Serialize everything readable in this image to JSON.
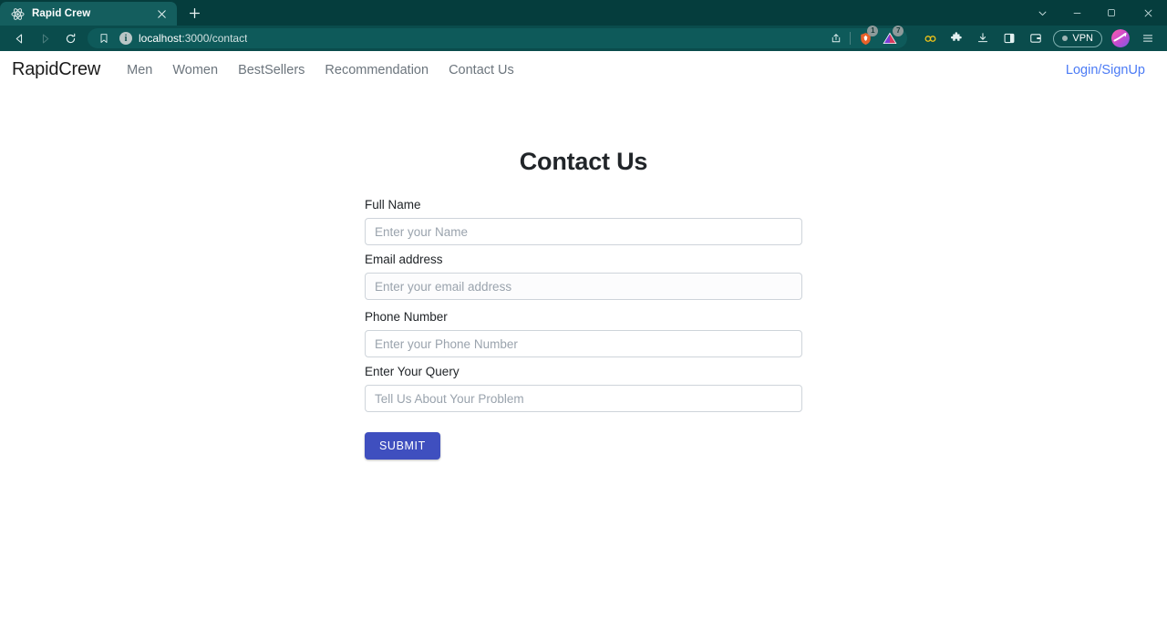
{
  "browser": {
    "tab": {
      "title": "Rapid Crew",
      "favicon_icon": "react-atom-icon",
      "close_icon": "close-icon"
    },
    "new_tab_label": "+",
    "window_controls": {
      "tab_search_icon": "chevron-down-icon",
      "minimize_icon": "minimize-icon",
      "maximize_icon": "maximize-icon",
      "close_icon": "close-icon"
    },
    "nav": {
      "back_icon": "back-arrow-icon",
      "forward_icon": "forward-arrow-icon",
      "reload_icon": "reload-icon",
      "bookmark_icon": "bookmark-icon"
    },
    "omnibox": {
      "site_info_icon": "info-circle-icon",
      "url_host": "localhost",
      "url_path": ":3000/contact",
      "share_icon": "share-icon",
      "shield_icon": "brave-shield-icon",
      "shield_badge": "1",
      "warning_icon": "triangle-alert-icon",
      "warning_badge": "7"
    },
    "toolbar_right": {
      "leo_icon": "leo-ai-icon",
      "extensions_icon": "puzzle-extension-icon",
      "downloads_icon": "download-icon",
      "sidebar_icon": "sidebar-panel-icon",
      "wallet_icon": "brave-wallet-icon",
      "vpn_label": "VPN",
      "profile_icon": "profile-avatar-icon",
      "menu_icon": "hamburger-menu-icon"
    }
  },
  "site": {
    "brand": "RapidCrew",
    "nav_links": [
      {
        "label": "Men"
      },
      {
        "label": "Women"
      },
      {
        "label": "BestSellers"
      },
      {
        "label": "Recommendation"
      },
      {
        "label": "Contact Us"
      }
    ],
    "auth_link": "Login/SignUp"
  },
  "page": {
    "title": "Contact Us",
    "fields": [
      {
        "label": "Full Name",
        "placeholder": "Enter your Name",
        "value": ""
      },
      {
        "label": "Email address",
        "placeholder": "Enter your email address",
        "value": ""
      },
      {
        "label": "Phone Number",
        "placeholder": "Enter your Phone Number",
        "value": ""
      },
      {
        "label": "Enter Your Query",
        "placeholder": "Tell Us About Your Problem",
        "value": ""
      }
    ],
    "submit_label": "SUBMIT"
  },
  "colors": {
    "chrome_tabstrip": "#053d3d",
    "chrome_toolbar": "#0a4c4c",
    "active_tab": "#145e5e",
    "accent_link": "#4b7bf5",
    "submit_button": "#3f4fbf",
    "heading": "#212529",
    "nav_link": "#6c757d",
    "input_border": "#ced4da"
  }
}
